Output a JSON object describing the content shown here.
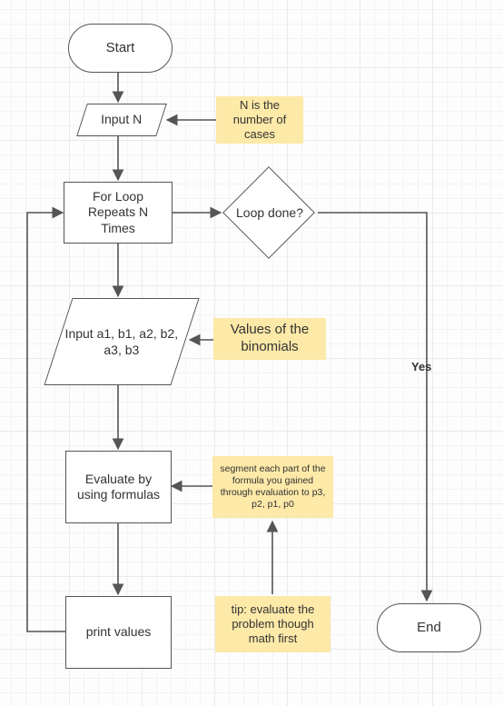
{
  "terminators": {
    "start": "Start",
    "end": "End"
  },
  "io": {
    "input_n": "Input N",
    "input_coeffs": "Input a1, b1, a2, b2, a3, b3"
  },
  "process": {
    "for_loop": "For Loop Repeats N Times",
    "evaluate": "Evaluate by using formulas",
    "print": "print values"
  },
  "decision": {
    "loop_done": "Loop done?"
  },
  "notes": {
    "n_desc": "N is the number of cases",
    "binomials": "Values of the binomials",
    "segment": "segment each part of the formula you gained through evaluation to p3, p2, p1, p0",
    "tip": "tip: evaluate the problem though math first"
  },
  "labels": {
    "yes": "Yes"
  }
}
